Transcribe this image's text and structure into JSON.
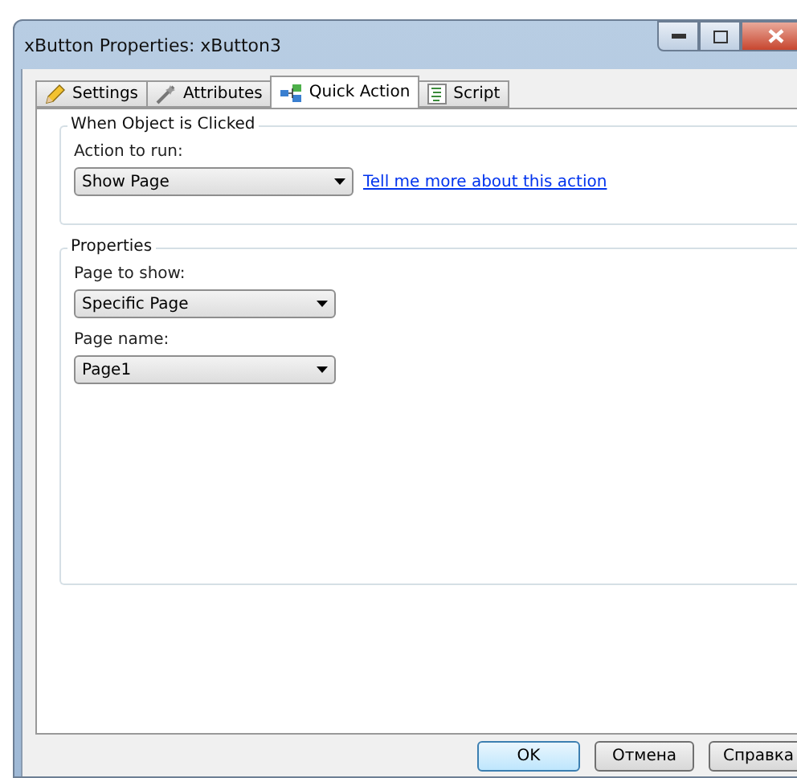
{
  "window": {
    "title": "xButton Properties: xButton3"
  },
  "tabs": [
    {
      "label": "Settings",
      "selected": false
    },
    {
      "label": "Attributes",
      "selected": false
    },
    {
      "label": "Quick Action",
      "selected": true
    },
    {
      "label": "Script",
      "selected": false
    }
  ],
  "click_group": {
    "title": "When Object is Clicked",
    "action_label": "Action to run:",
    "action_value": "Show Page",
    "help_link": "Tell me more about this action"
  },
  "properties_group": {
    "title": "Properties",
    "fields": [
      {
        "label": "Page to show:",
        "value": "Specific Page"
      },
      {
        "label": "Page name:",
        "value": "Page1"
      }
    ]
  },
  "buttons": [
    {
      "label": "OK",
      "default": true
    },
    {
      "label": "Отмена",
      "default": false
    },
    {
      "label": "Справка",
      "default": false
    }
  ]
}
